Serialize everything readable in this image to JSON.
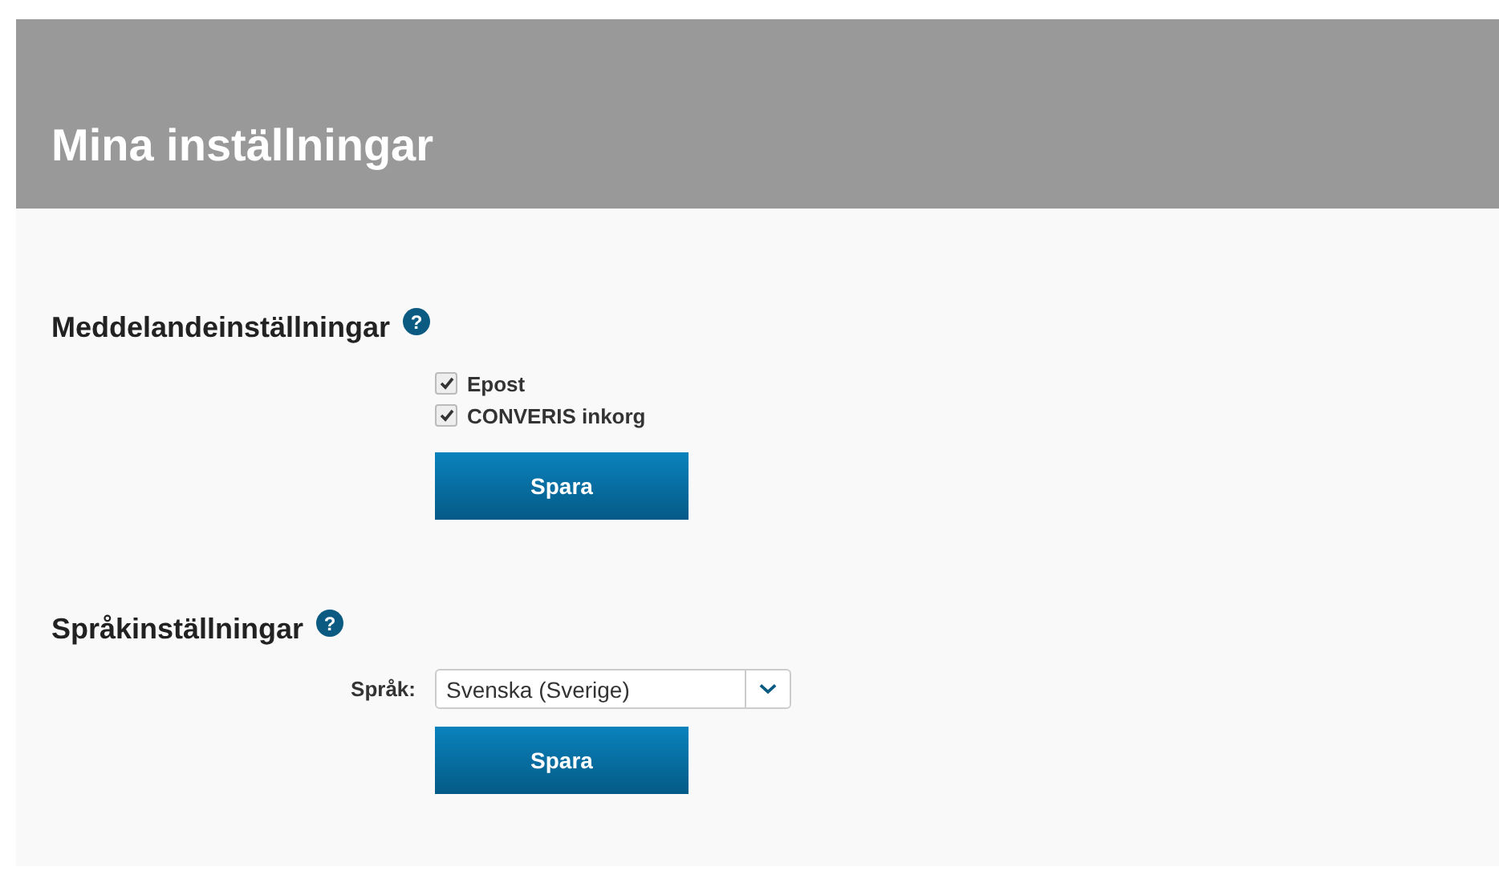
{
  "header": {
    "title": "Mina inställningar"
  },
  "notifications": {
    "title": "Meddelandeinställningar",
    "help": "?",
    "options": [
      {
        "label": "Epost",
        "checked": true
      },
      {
        "label": "CONVERIS inkorg",
        "checked": true
      }
    ],
    "button": "Spara"
  },
  "language": {
    "title": "Språkinställningar",
    "help": "?",
    "label": "Språk:",
    "value": "Svenska (Sverige)",
    "button": "Spara"
  }
}
